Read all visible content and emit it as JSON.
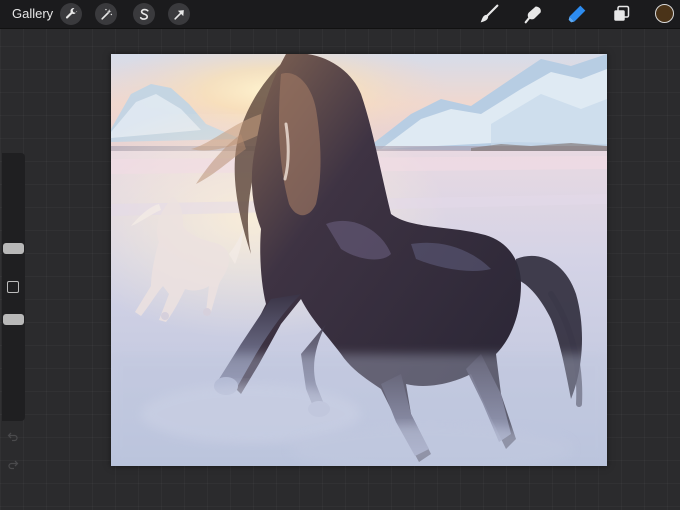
{
  "toolbar": {
    "gallery_label": "Gallery",
    "left_tools": [
      {
        "name": "actions",
        "icon": "wrench-icon"
      },
      {
        "name": "adjustments",
        "icon": "magic-wand-icon"
      },
      {
        "name": "selection",
        "icon": "selection-s-icon"
      },
      {
        "name": "transform",
        "icon": "arrow-cursor-icon"
      }
    ],
    "right_tools": [
      {
        "name": "brush",
        "icon": "brush-icon"
      },
      {
        "name": "smudge",
        "icon": "smudge-finger-icon"
      },
      {
        "name": "eraser",
        "icon": "eraser-icon",
        "active": true
      },
      {
        "name": "layers",
        "icon": "layers-icon"
      }
    ],
    "current_color": "#4a3318",
    "accent_color": "#2d8cf0"
  },
  "sidebar": {
    "brush_size_level": 0.35,
    "opacity_level": 0.62,
    "undo_icon": "undo-arrow-icon",
    "redo_icon": "redo-arrow-icon"
  },
  "canvas": {
    "description_icon": "painting-horses-in-snow"
  }
}
